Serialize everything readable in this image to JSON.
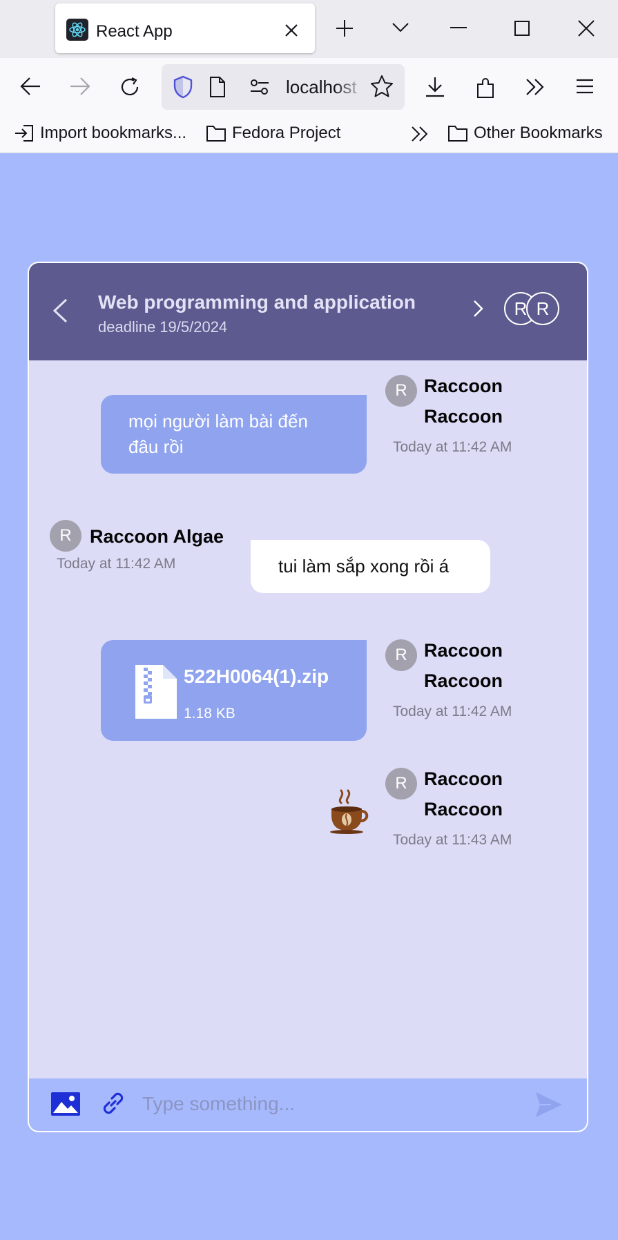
{
  "browser": {
    "tab_title": "React App",
    "url": "localhost",
    "bookmarks": {
      "import": "Import bookmarks...",
      "fedora": "Fedora Project",
      "other": "Other Bookmarks"
    }
  },
  "chat": {
    "title": "Web programming and application",
    "subtitle": "deadline 19/5/2024",
    "members": [
      {
        "initial": "R"
      },
      {
        "initial": "R"
      }
    ],
    "messages": [
      {
        "own": true,
        "avatar": "R",
        "sender": "Raccoon Raccoon",
        "time": "Today at 11:42 AM",
        "text": "mọi người làm bài đến đâu rồi"
      },
      {
        "own": false,
        "avatar": "R",
        "sender": "Raccoon Algae",
        "time": "Today at 11:42 AM",
        "text": "tui làm sắp xong rồi á"
      },
      {
        "own": true,
        "avatar": "R",
        "sender": "Raccoon Raccoon",
        "time": "Today at 11:42 AM",
        "file": {
          "name": "522H0064(1).zip",
          "size": "1.18 KB"
        }
      },
      {
        "own": true,
        "avatar": "R",
        "sender": "Raccoon Raccoon",
        "time": "Today at 11:43 AM",
        "sticker": "coffee-cup"
      }
    ],
    "input_placeholder": "Type something...",
    "colors": {
      "page_bg": "#a7b9fd",
      "header_bg": "#5c5a8e",
      "chat_bg": "#dddcf7",
      "own_bubble": "#8fa3ef",
      "other_bubble": "#ffffff",
      "send_icon": "#8fa3ef",
      "image_icon": "#1f2fd6"
    }
  }
}
